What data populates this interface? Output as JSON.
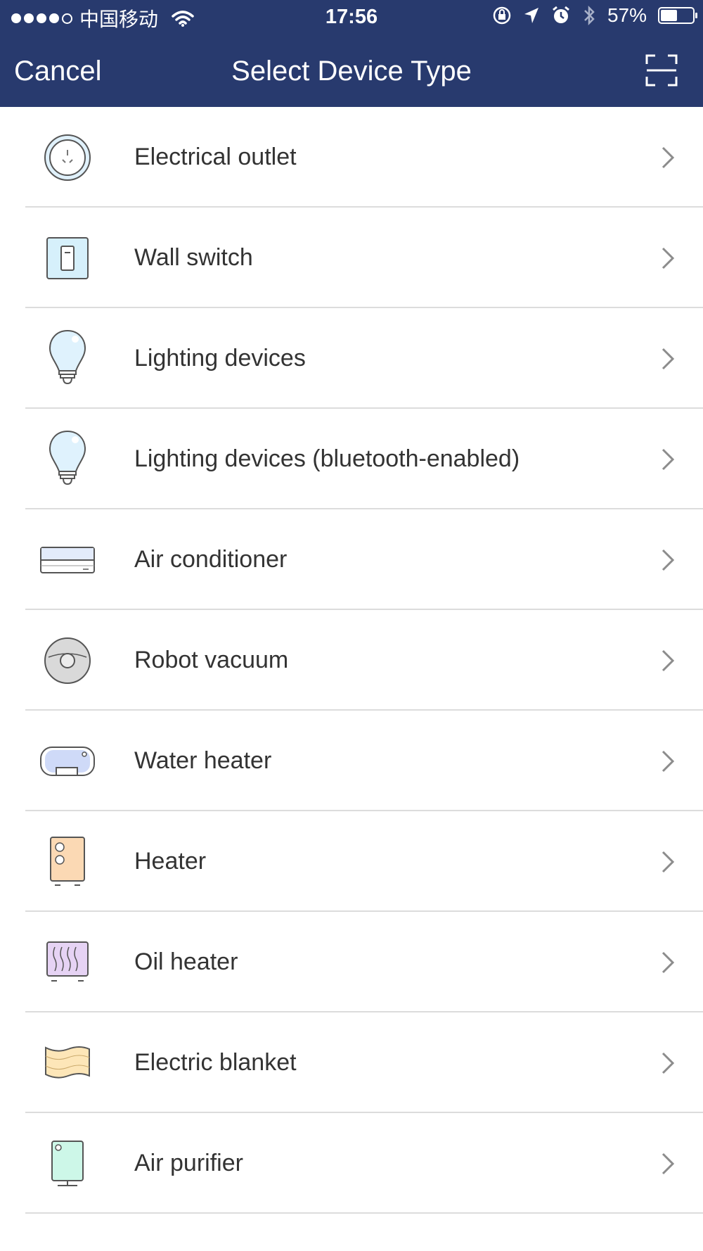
{
  "status_bar": {
    "carrier": "中国移动",
    "time": "17:56",
    "battery": "57%",
    "battery_level": 0.57,
    "icons": [
      "signal-dots",
      "wifi-icon",
      "rotation-lock-icon",
      "location-icon",
      "alarm-icon",
      "bluetooth-icon",
      "battery-icon"
    ]
  },
  "nav": {
    "cancel_label": "Cancel",
    "title": "Select Device Type",
    "scan_icon": "scan-icon"
  },
  "devices": [
    {
      "label": "Electrical outlet",
      "icon": "outlet-icon"
    },
    {
      "label": "Wall switch",
      "icon": "wall-switch-icon"
    },
    {
      "label": "Lighting devices",
      "icon": "light-bulb-icon"
    },
    {
      "label": "Lighting devices (bluetooth-enabled)",
      "icon": "light-bulb-icon"
    },
    {
      "label": "Air conditioner",
      "icon": "air-conditioner-icon"
    },
    {
      "label": "Robot vacuum",
      "icon": "robot-vacuum-icon"
    },
    {
      "label": "Water heater",
      "icon": "water-heater-icon"
    },
    {
      "label": "Heater",
      "icon": "heater-icon"
    },
    {
      "label": "Oil heater",
      "icon": "oil-heater-icon"
    },
    {
      "label": "Electric blanket",
      "icon": "electric-blanket-icon"
    },
    {
      "label": "Air purifier",
      "icon": "air-purifier-icon"
    }
  ],
  "colors": {
    "header_bg": "#283a6e",
    "divider": "#dcdcdc",
    "text": "#333333"
  }
}
